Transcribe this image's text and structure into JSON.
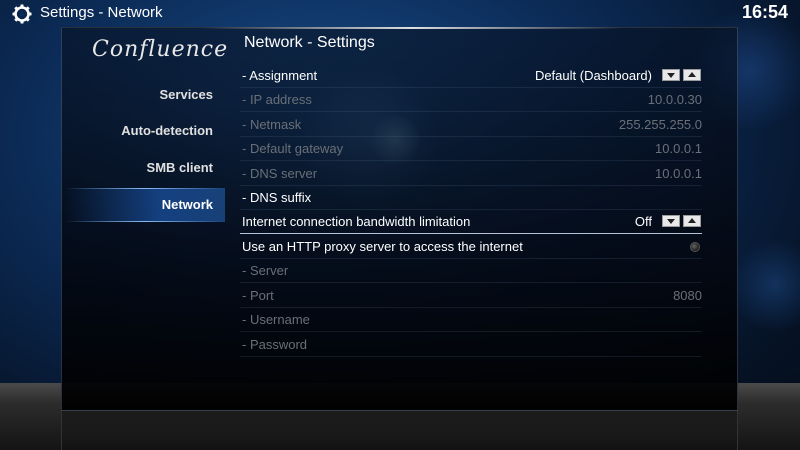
{
  "topbar": {
    "title": "Settings  - Network",
    "icon": "gear-icon",
    "clock": "16:54"
  },
  "logo": {
    "text": "Confluence"
  },
  "sidebar": {
    "items": [
      {
        "label": "Services",
        "active": false
      },
      {
        "label": "Auto-detection",
        "active": false
      },
      {
        "label": "SMB client",
        "active": false
      },
      {
        "label": "Network",
        "active": true
      }
    ]
  },
  "content": {
    "title": "Network - Settings",
    "rows": [
      {
        "label": "- Assignment",
        "value": "Default (Dashboard)",
        "control": "spinner",
        "disabled": false
      },
      {
        "label": "- IP address",
        "value": "10.0.0.30",
        "control": "text",
        "disabled": true
      },
      {
        "label": "- Netmask",
        "value": "255.255.255.0",
        "control": "text",
        "disabled": true
      },
      {
        "label": "- Default gateway",
        "value": "10.0.0.1",
        "control": "text",
        "disabled": true
      },
      {
        "label": "- DNS server",
        "value": "10.0.0.1",
        "control": "text",
        "disabled": true
      },
      {
        "label": "- DNS suffix",
        "value": "",
        "control": "text",
        "disabled": false
      },
      {
        "label": "Internet connection bandwidth limitation",
        "value": "Off",
        "control": "spinner",
        "disabled": false,
        "selected": true
      },
      {
        "label": "Use an HTTP proxy server to access the internet",
        "value": "",
        "control": "radio",
        "checked": false,
        "disabled": false
      },
      {
        "label": "- Server",
        "value": "",
        "control": "text",
        "disabled": true
      },
      {
        "label": "- Port",
        "value": "8080",
        "control": "text",
        "disabled": true
      },
      {
        "label": "- Username",
        "value": "",
        "control": "text",
        "disabled": true
      },
      {
        "label": "- Password",
        "value": "",
        "control": "text",
        "disabled": true
      }
    ]
  },
  "colors": {
    "accent": "#2a6ec8",
    "disabled_text": "#6a6f78",
    "background": "#0b2a55"
  }
}
